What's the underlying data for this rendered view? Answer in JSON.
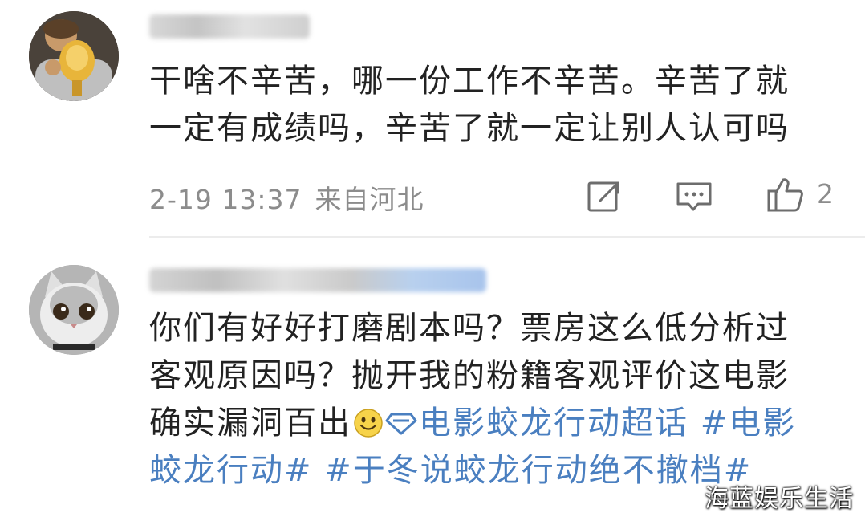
{
  "comments": [
    {
      "text_lines": [
        "干啥不辛苦，哪一份工作不辛苦。辛苦了就",
        "一定有成绩吗，辛苦了就一定让别人认可吗"
      ],
      "date": "2-19 13:37",
      "location": "来自河北",
      "like_count": "2",
      "avatar_icon": "player-trophy-avatar-icon"
    },
    {
      "text_lines": [
        "你们有好好打磨剧本吗？票房这么低分析过",
        "客观原因吗？抛开我的粉籍客观评价这电影",
        "确实漏洞百出"
      ],
      "topics": [
        "电影蛟龙行动超话",
        "#电影",
        "蛟龙行动#",
        "#于冬说蛟龙行动绝不撤档#"
      ],
      "avatar_icon": "cat-avatar-icon"
    }
  ],
  "watermark": "海蓝娱乐生活",
  "colors": {
    "topic": "#4a7fc0",
    "meta": "#8c8c8c"
  }
}
